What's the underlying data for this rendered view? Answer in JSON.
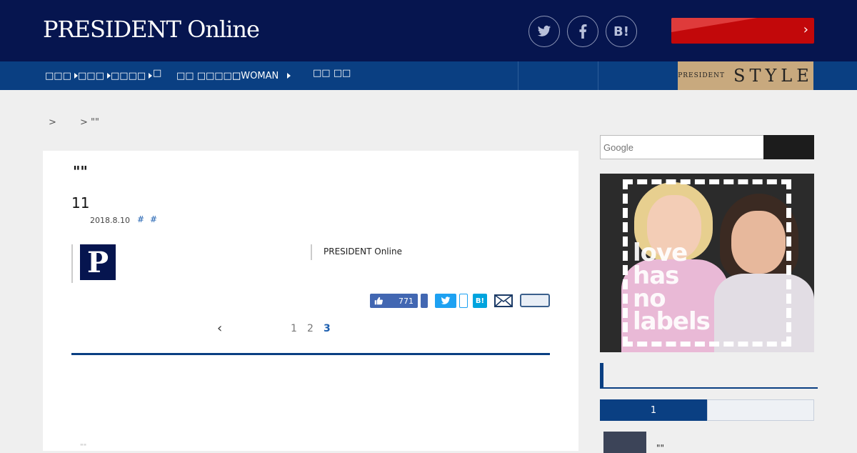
{
  "header": {
    "logo": "PRESIDENT Online",
    "social": {
      "twitter": "twitter-icon",
      "facebook": "facebook-icon",
      "hatena": "B!"
    },
    "subscribe_arrow": "›",
    "colors": {
      "header_bg": "#06154f",
      "nav_bg": "#0a3f82",
      "subscribe": "#c2080a",
      "style_banner": "#c8a97e"
    }
  },
  "nav": {
    "items": [
      "□□□",
      "□□□",
      "□□□□",
      "□",
      "□□ □□□□□",
      "□WOMAN",
      "□□ □□"
    ],
    "style_banner": {
      "small": "PRESIDENT",
      "big": "STYLE"
    }
  },
  "breadcrumb": {
    "text": ">        > \"\""
  },
  "article": {
    "quote": "\"\"",
    "title": "11",
    "date": "2018.8.10",
    "tags": [
      "#",
      "#"
    ],
    "author_logo": "P",
    "author_name": "PRESIDENT Online",
    "like_count": "771",
    "hatena_label": "B!",
    "pager": {
      "prev": "‹",
      "pages": [
        "1",
        "2",
        "3"
      ],
      "current": "3"
    },
    "faded_text": "\"\""
  },
  "sidebar": {
    "search_placeholder": "Google",
    "ad_text": [
      "love",
      "has",
      "no",
      "labels"
    ],
    "ranking_tab_active": "1",
    "ranking_item": "\"\""
  }
}
